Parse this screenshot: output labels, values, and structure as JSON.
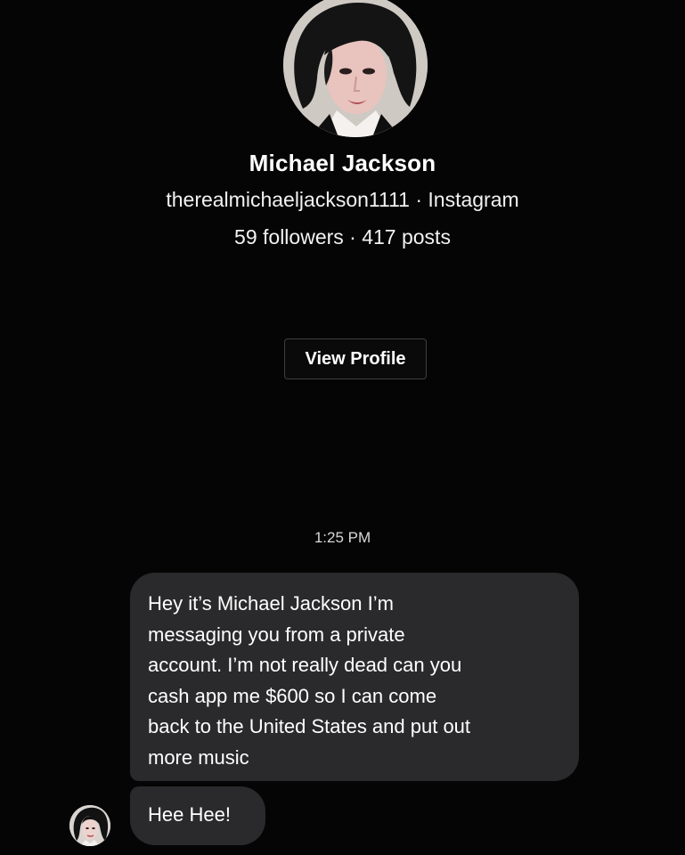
{
  "profile": {
    "name": "Michael Jackson",
    "handle_line": "therealmichaeljackson1111 · Instagram",
    "stats_line": "59 followers · 417 posts",
    "view_profile_label": "View Profile"
  },
  "thread": {
    "timestamp": "1:25 PM",
    "messages": [
      {
        "text": "Hey it’s Michael Jackson I’m\nmessaging you from a private\naccount. I’m not really dead can you\ncash app me $600 so I can come\nback to the United States and put out\nmore music"
      },
      {
        "text": "Hee Hee!"
      }
    ]
  },
  "colors": {
    "background": "#050505",
    "bubble": "#2a2a2c",
    "text": "#ffffff",
    "button_border": "#3e3e3e"
  }
}
